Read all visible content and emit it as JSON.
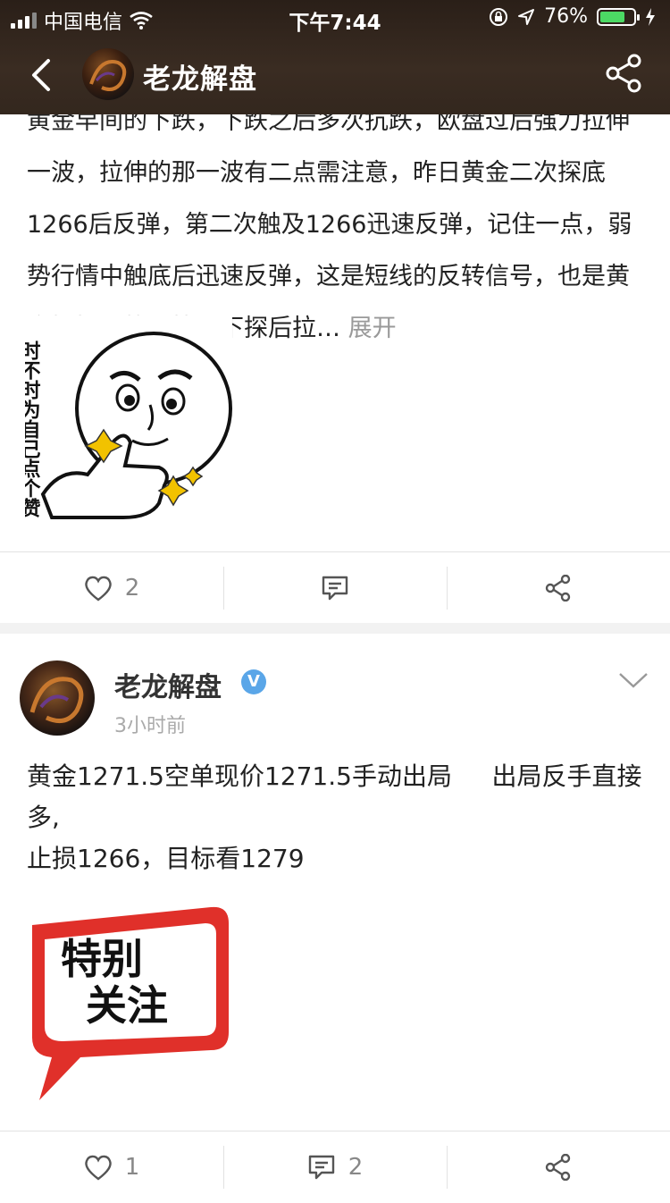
{
  "status": {
    "carrier": "中国电信",
    "time": "下午7:44",
    "battery": "76%",
    "battery_level": 0.76
  },
  "nav": {
    "title": "老龙解盘"
  },
  "post1": {
    "text": "黄金早间的下跌，下跌之后多次抗跌，欧盘过后强力拉伸一波，拉伸的那一波有二点需注意，昨日黄金二次探底1266后反弹，第二次触及1266迅速反弹，记住一点，弱势行情中触底后迅速反弹，这是短线的反转信号，也是黄金惯性走势，快速下探后拉…",
    "expand_label": "展开",
    "sticker_text": "时不时为自己点个赞",
    "likes": "2"
  },
  "post2": {
    "author": "老龙解盘",
    "verified_badge": "V",
    "time": "3小时前",
    "text": "黄金1271.5空单现价1271.5手动出局     出局反手直接多,\n止损1266，目标看1279",
    "sticker_text": "特别关注",
    "likes": "1",
    "comments": "2"
  },
  "icons": [
    "back-icon",
    "share-icon",
    "heart-icon",
    "comment-icon",
    "chevron-down-icon",
    "wifi-icon",
    "location-icon",
    "lock-rotation-icon"
  ],
  "colors": {
    "header_bg": "#2f241c",
    "accent_red": "#e0302a",
    "verified_blue": "#5aa6e8",
    "battery_green": "#4cd964"
  }
}
